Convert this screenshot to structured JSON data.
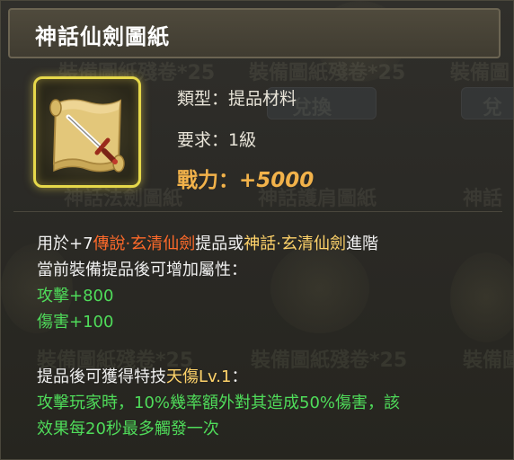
{
  "item": {
    "name": "神話仙劍圖紙",
    "type_label": "類型：",
    "type_value": "提品材料",
    "req_label": "要求：",
    "req_value": "1級",
    "power_label": "戰力：",
    "power_value": "+5000",
    "icon": "sword-scroll-icon"
  },
  "description": {
    "line1": {
      "prefix": "用於+7",
      "legend_sword": "傳說·玄清仙劍",
      "mid": "提品或",
      "myth_sword": "神話·玄清仙劍",
      "suffix": "進階"
    },
    "line2": "當前裝備提品後可增加屬性：",
    "stats": [
      "攻擊+800",
      "傷害+100"
    ],
    "skill_prefix": "提品後可獲得特技",
    "skill_name": "天傷Lv.1",
    "skill_suffix": "：",
    "effect_line1": "攻擊玩家時，10%幾率額外對其造成50%傷害，該",
    "effect_line2": "效果每20秒最多觸發一次"
  },
  "background": {
    "labels": [
      "裝備圖紙殘卷*25",
      "裝備圖紙殘卷*25",
      "裝備圖",
      "神話法劍圖紙",
      "神話護肩圖紙",
      "神話",
      "裝備圖紙殘卷*25",
      "裝備圖紙殘卷*25",
      "裝備圖"
    ],
    "buttons": [
      "兌換",
      "兌"
    ]
  },
  "colors": {
    "legend": "#ff6a2a",
    "myth": "#ffd36a",
    "stat": "#4fdc5a",
    "power": "#f2b24a",
    "frame": "#e6d84a"
  }
}
